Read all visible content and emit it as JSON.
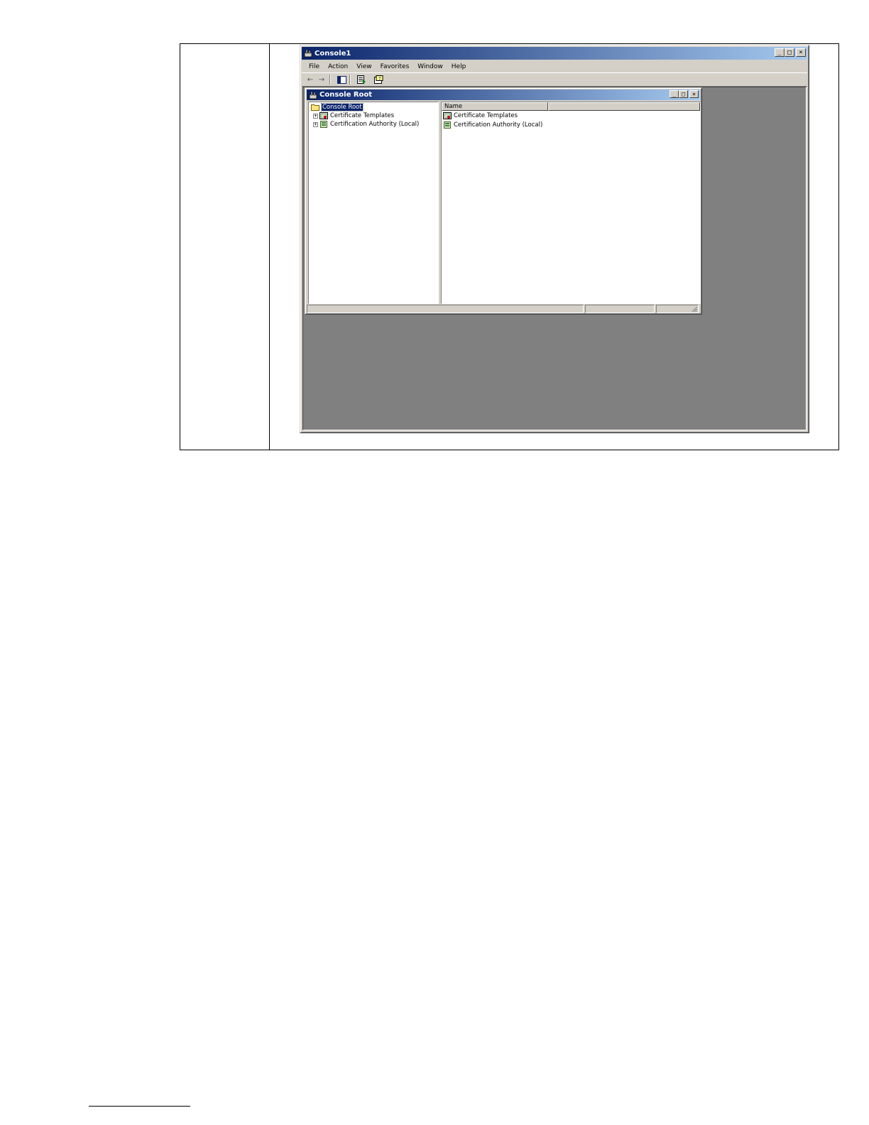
{
  "main_window": {
    "title": "Console1",
    "menu": [
      "File",
      "Action",
      "View",
      "Favorites",
      "Window",
      "Help"
    ],
    "window_buttons": {
      "minimize": "_",
      "maximize": "□",
      "close": "×"
    }
  },
  "child_window": {
    "title": "Console Root",
    "window_buttons": {
      "minimize": "_",
      "maximize": "□",
      "close": "×"
    },
    "tree": {
      "root": "Console Root",
      "nodes": [
        {
          "label": "Certificate Templates",
          "expander": "+"
        },
        {
          "label": "Certification Authority (Local)",
          "expander": "+"
        }
      ]
    },
    "list": {
      "columns": [
        "Name",
        ""
      ],
      "rows": [
        "Certificate Templates",
        "Certification Authority (Local)"
      ]
    }
  },
  "colors": {
    "title_start": "#0a246a",
    "title_end": "#a6caf0",
    "face": "#d4d0c8",
    "mdi_background": "#808080"
  }
}
